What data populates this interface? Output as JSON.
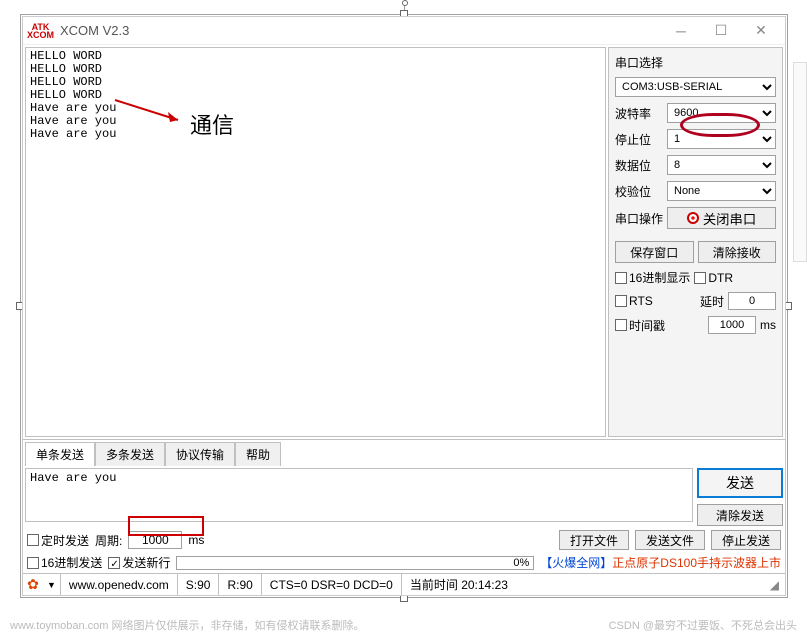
{
  "window": {
    "title": "XCOM V2.3",
    "logo_top": "ATK",
    "logo_bot": "XCOM"
  },
  "recv_lines": "HELLO WORD\nHELLO WORD\nHELLO WORD\nHELLO WORD\nHave are you\nHave are you\nHave are you",
  "annotation": {
    "label": "通信"
  },
  "side": {
    "title": "串口选择",
    "port": "COM3:USB-SERIAL",
    "baud_label": "波特率",
    "baud": "9600",
    "stop_label": "停止位",
    "stop": "1",
    "data_label": "数据位",
    "data": "8",
    "parity_label": "校验位",
    "parity": "None",
    "op_label": "串口操作",
    "close_btn": "关闭串口",
    "save_win": "保存窗口",
    "clear_recv": "清除接收",
    "hex_show": "16进制显示",
    "dtr": "DTR",
    "rts": "RTS",
    "delay_label": "延时",
    "delay_val": "0",
    "timestamp": "时间戳",
    "ts_val": "1000",
    "ms1": "ms"
  },
  "tabs": {
    "t1": "单条发送",
    "t2": "多条发送",
    "t3": "协议传输",
    "t4": "帮助"
  },
  "send_text": "Have are you",
  "buttons": {
    "send": "发送",
    "clear_send": "清除发送"
  },
  "ctrl": {
    "timed": "定时发送",
    "period_label": "周期:",
    "period": "1000",
    "ms": "ms",
    "open_file": "打开文件",
    "send_file": "发送文件",
    "stop_send": "停止发送",
    "hex_send": "16进制发送",
    "newline": "发送新行",
    "progress": "0%"
  },
  "ad": {
    "prefix": "【火爆全网】",
    "text": "正点原子DS100手持示波器上市"
  },
  "status": {
    "url": "www.openedv.com",
    "s": "S:90",
    "r": "R:90",
    "cts": "CTS=0 DSR=0 DCD=0",
    "time_label": "当前时间",
    "time": "20:14:23"
  },
  "footer": {
    "left": "www.toymoban.com  网络图片仅供展示，非存储，如有侵权请联系删除。",
    "right": "CSDN @最穷不过要饭、不死总会出头"
  }
}
